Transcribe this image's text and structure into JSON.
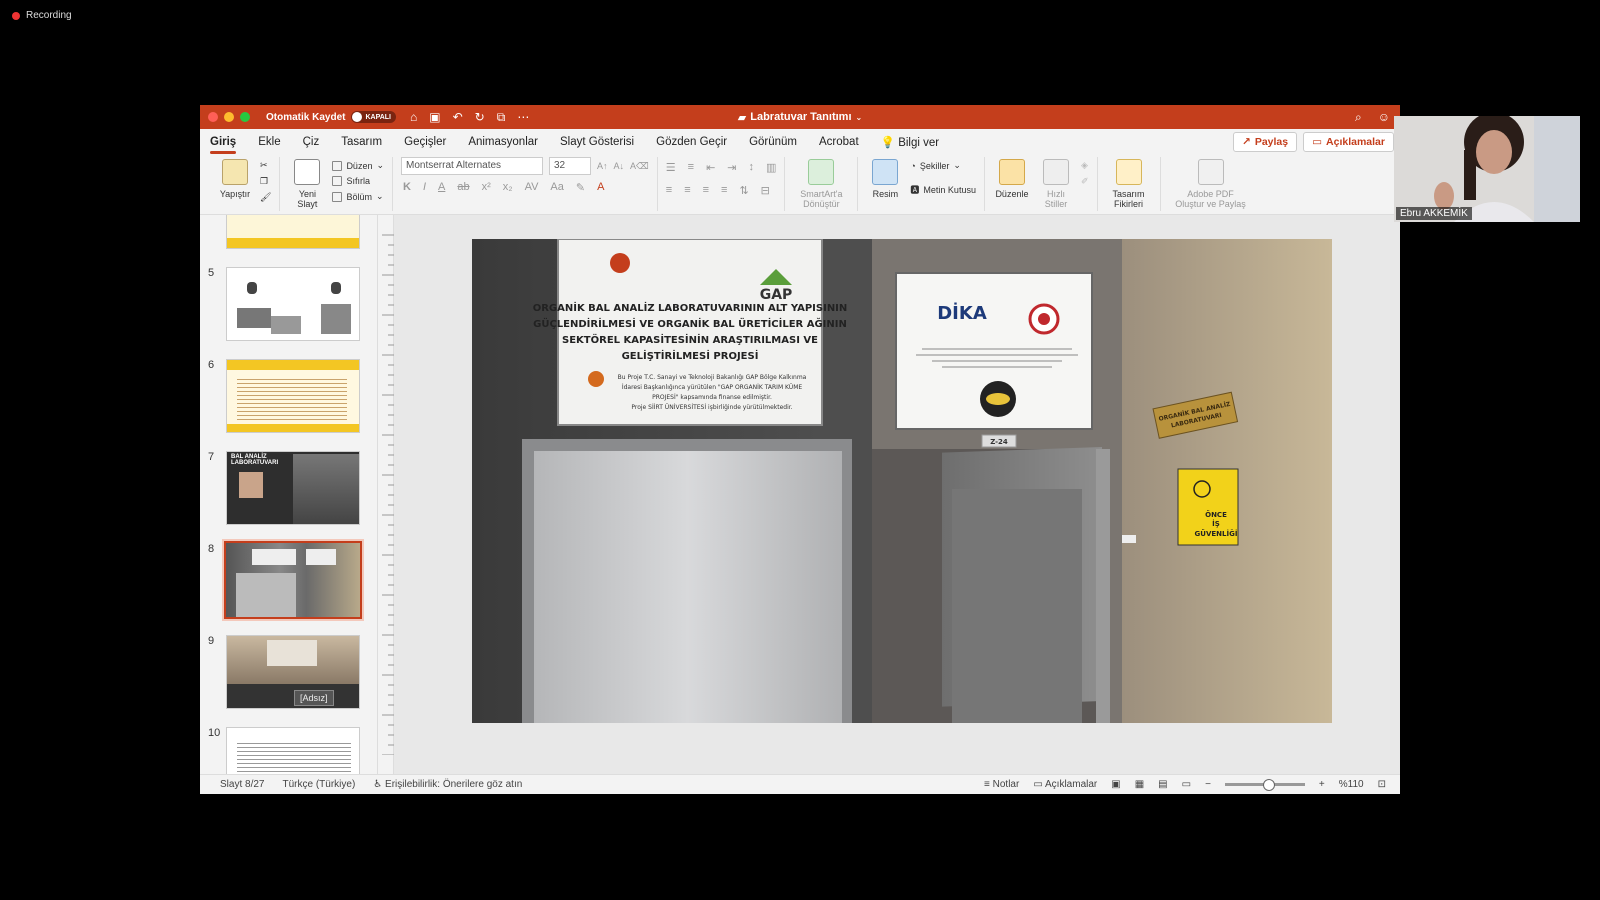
{
  "recording": {
    "label": "Recording"
  },
  "titlebar": {
    "autosave_label": "Otomatik Kaydet",
    "autosave_state": "KAPALI",
    "doc_title": "Labratuvar Tanıtımı"
  },
  "tabs": [
    "Giriş",
    "Ekle",
    "Çiz",
    "Tasarım",
    "Geçişler",
    "Animasyonlar",
    "Slayt Gösterisi",
    "Gözden Geçir",
    "Görünüm",
    "Acrobat"
  ],
  "tell_me": "Bilgi ver",
  "share_button": "Paylaş",
  "comments_button": "Açıklamalar",
  "ribbon": {
    "paste": "Yapıştır",
    "new_slide_1": "Yeni",
    "new_slide_2": "Slayt",
    "layout": "Düzen",
    "reset": "Sıfırla",
    "section": "Bölüm",
    "font_name": "Montserrat Alternates",
    "font_size": "32",
    "smartart_1": "SmartArt'a",
    "smartart_2": "Dönüştür",
    "picture": "Resim",
    "shapes": "Şekiller",
    "textbox": "Metin Kutusu",
    "arrange": "Düzenle",
    "quick_styles_1": "Hızlı",
    "quick_styles_2": "Stiller",
    "design_ideas_1": "Tasarım",
    "design_ideas_2": "Fikirleri",
    "adobe_1": "Adobe PDF",
    "adobe_2": "Oluştur ve Paylaş"
  },
  "thumbnails": [
    {
      "num": "5"
    },
    {
      "num": "6"
    },
    {
      "num": "7",
      "title": "BAL ANALİZ LABORATUVARI"
    },
    {
      "num": "8"
    },
    {
      "num": "9"
    },
    {
      "num": "10"
    }
  ],
  "tooltip": "[Adsız]",
  "slide": {
    "sign1_lines": [
      "ORGANİK BAL ANALİZ LABORATUVARININ ALT YAPISININ",
      "GÜÇLENDİRİLMESİ VE ORGANİK BAL ÜRETİCİLER AĞININ",
      "SEKTÖREL KAPASİTESİNİN ARAŞTIRILMASI VE",
      "GELİŞTİRİLMESİ PROJESİ"
    ],
    "sign1_small": [
      "Bu Proje T.C. Sanayi ve Teknoloji Bakanlığı GAP Bölge Kalkınma",
      "İdaresi Başkanlığınca yürütülen \"GAP ORGANİK TARIM KÜME",
      "PROJESİ\" kapsamında finanse edilmiştir.",
      "Proje SİİRT ÜNİVERSİTESİ işbirliğinde yürütülmektedir."
    ],
    "gap_logo": "GAP",
    "dika_logo": "DİKA",
    "room_number": "Z-24",
    "door_sign": [
      "ORGANİK BAL ANALİZ",
      "LABORATUVARI"
    ],
    "safety_sign": [
      "ÖNCE",
      "İŞ",
      "GÜVENLİĞİ"
    ]
  },
  "status": {
    "slide_counter": "Slayt 8/27",
    "language": "Türkçe (Türkiye)",
    "accessibility": "Erişilebilirlik: Önerilere göz atın",
    "notes": "Notlar",
    "comments": "Açıklamalar",
    "zoom": "%110"
  },
  "webcam": {
    "name": "Ebru AKKEMİK"
  },
  "colors": {
    "accent": "#c43e1c",
    "window_bg": "#f3f3f3"
  }
}
